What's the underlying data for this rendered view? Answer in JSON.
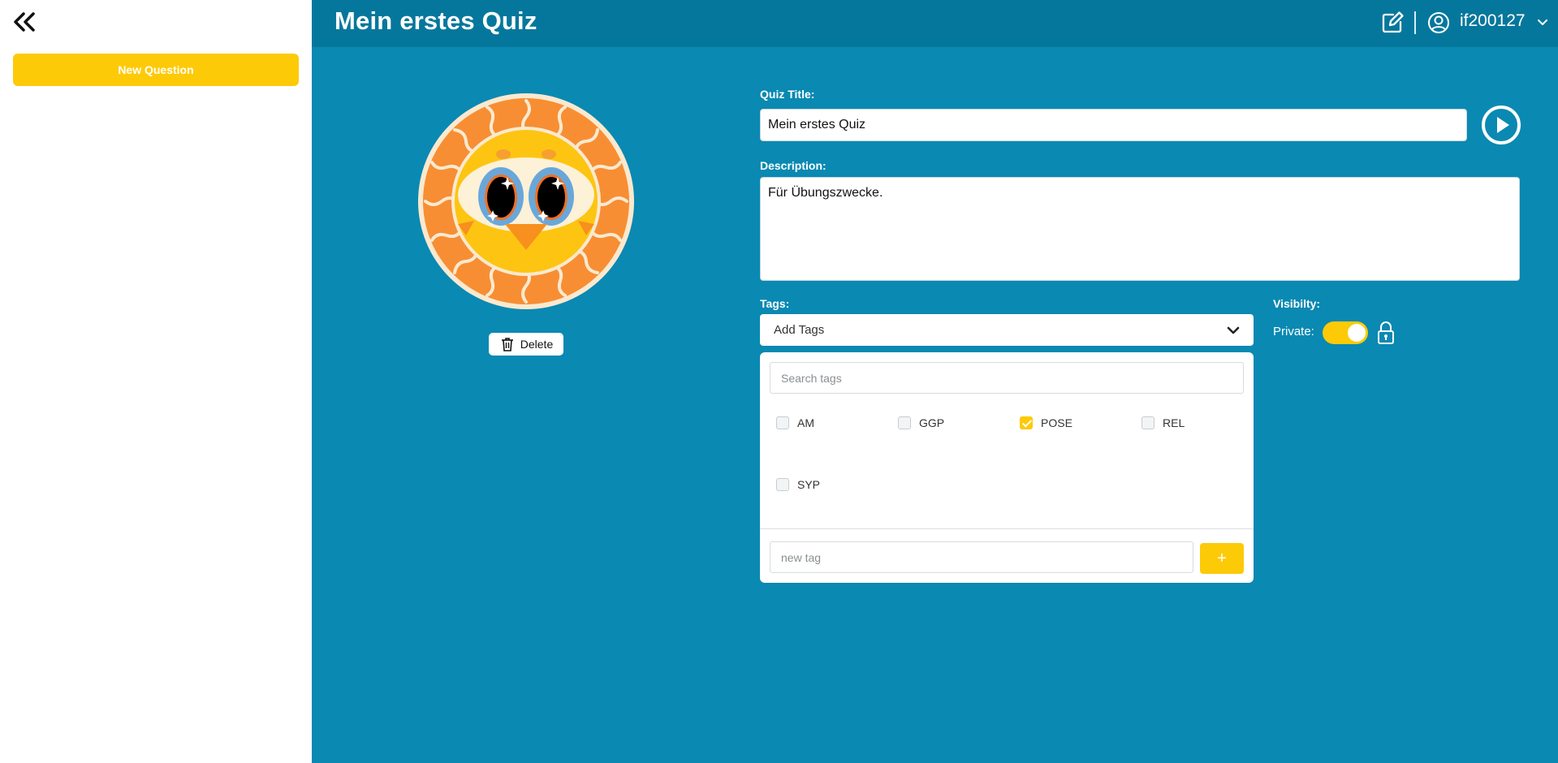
{
  "sidebar": {
    "new_question_label": "New Question"
  },
  "header": {
    "title": "Mein erstes Quiz",
    "username": "if200127"
  },
  "avatar": {
    "delete_label": "Delete"
  },
  "form": {
    "quiz_title_label": "Quiz Title:",
    "quiz_title_value": "Mein erstes Quiz",
    "description_label": "Description:",
    "description_value": "Für Übungszwecke.",
    "tags_label": "Tags:",
    "tags_placeholder": "Add Tags",
    "tag_search_placeholder": "Search tags",
    "tags": [
      {
        "name": "AM",
        "checked": false
      },
      {
        "name": "GGP",
        "checked": false
      },
      {
        "name": "POSE",
        "checked": true
      },
      {
        "name": "REL",
        "checked": false
      },
      {
        "name": "SYP",
        "checked": false
      }
    ],
    "new_tag_placeholder": "new tag",
    "add_tag_label": "+",
    "visibility_label": "Visibilty:",
    "private_label": "Private:",
    "private_enabled": true
  },
  "colors": {
    "background": "#0a89b2",
    "header": "#06779c",
    "accent": "#fdca08"
  },
  "icons": {
    "collapse": "double-chevron-left-icon",
    "edit": "edit-icon",
    "user": "user-circle-icon",
    "play": "play-circle-icon",
    "delete": "trash-icon",
    "dropdown": "chevron-down-icon",
    "lock": "lock-icon"
  }
}
